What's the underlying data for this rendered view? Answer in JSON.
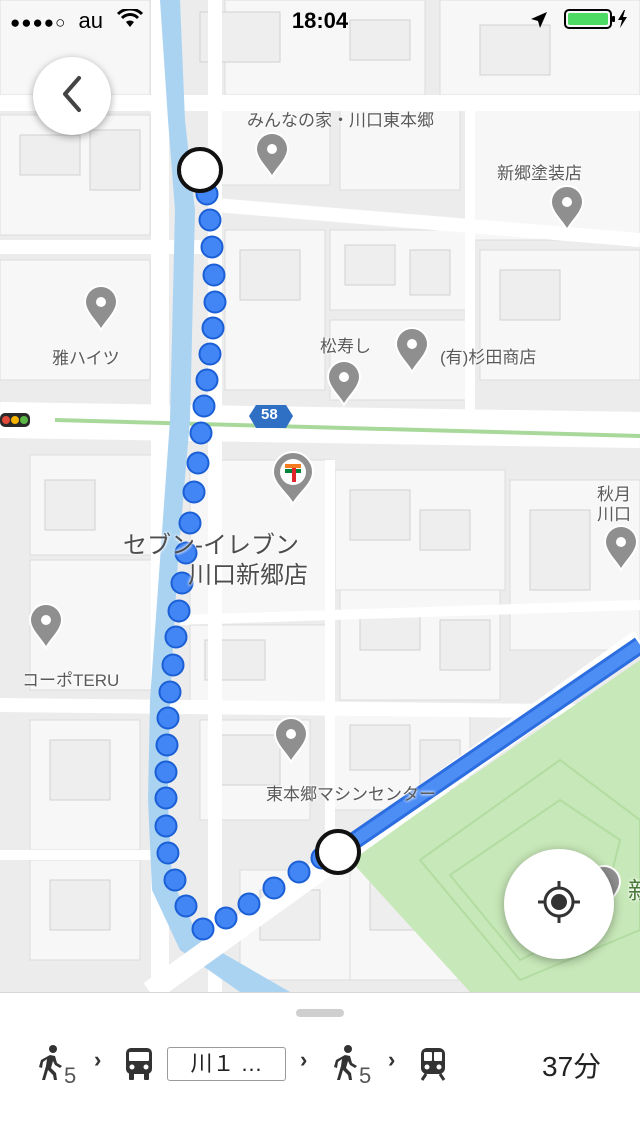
{
  "status_bar": {
    "signal": "●●●●○",
    "carrier": "au",
    "time": "18:04"
  },
  "map": {
    "pois": [
      {
        "label": "みんなの家・川口東本郷"
      },
      {
        "label": "新郷塗装店"
      },
      {
        "label": "雅ハイツ"
      },
      {
        "label": "松寿し"
      },
      {
        "label": "(有)杉田商店"
      },
      {
        "label": "セブン-イレブン"
      },
      {
        "label": "川口新郷店"
      },
      {
        "label": "コーポTERU"
      },
      {
        "label": "東本郷マシンセンター"
      },
      {
        "label": "秋月"
      },
      {
        "label": "川口"
      },
      {
        "label": "新"
      }
    ],
    "route_number": "58",
    "colors": {
      "route_blue": "#4285f4",
      "route_dot_outline": "#1a5fd6",
      "park_green": "#c7e8b8",
      "water": "#aad3f2",
      "road_badge": "#2f6fc4"
    }
  },
  "controls": {
    "back_icon": "chevron-left-icon",
    "locate_icon": "crosshair-location-icon"
  },
  "route_summary": {
    "walk_min_1": "5",
    "bus_line": "川１ …",
    "walk_min_2": "5",
    "total_duration": "37分"
  }
}
